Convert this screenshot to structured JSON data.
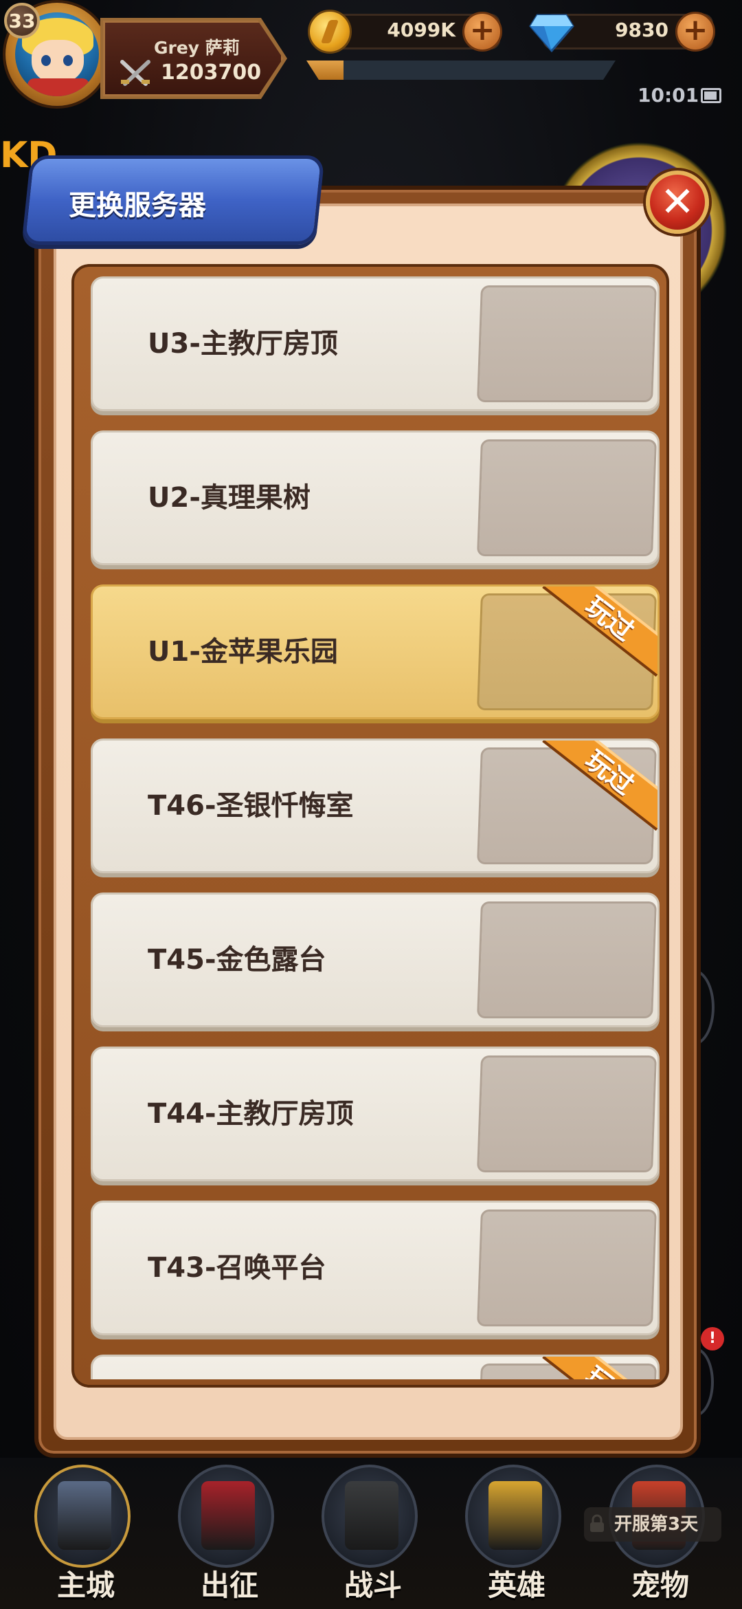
{
  "hud": {
    "level": "33",
    "player_name": "Grey 萨莉",
    "power": "1203700",
    "gold": "4099K",
    "gems": "9830",
    "clock": "10:01",
    "xp_fraction": 0.12,
    "bg_text": "KD"
  },
  "dialog": {
    "title": "更换服务器",
    "close_icon": "close-icon",
    "played_label": "玩过",
    "servers": [
      {
        "name": "U3-主教厅房顶",
        "selected": false,
        "played": false
      },
      {
        "name": "U2-真理果树",
        "selected": false,
        "played": false
      },
      {
        "name": "U1-金苹果乐园",
        "selected": true,
        "played": true
      },
      {
        "name": "T46-圣银忏悔室",
        "selected": false,
        "played": true
      },
      {
        "name": "T45-金色露台",
        "selected": false,
        "played": false
      },
      {
        "name": "T44-主教厅房顶",
        "selected": false,
        "played": false
      },
      {
        "name": "T43-召唤平台",
        "selected": false,
        "played": false
      },
      {
        "name": "",
        "selected": false,
        "played": true
      }
    ]
  },
  "alert_badge": "!",
  "nav": {
    "items": [
      {
        "label": "主城",
        "icon": "castle-icon",
        "active": true
      },
      {
        "label": "出征",
        "icon": "expedition-icon",
        "active": false
      },
      {
        "label": "战斗",
        "icon": "battle-shield-icon",
        "active": false
      },
      {
        "label": "英雄",
        "icon": "hero-crest-icon",
        "active": false
      },
      {
        "label": "宠物",
        "icon": "pet-dragon-icon",
        "active": false
      }
    ],
    "lock_text": "开服第3天"
  },
  "colors": {
    "panel_wood": "#8b4d22",
    "title_blue": "#3f63c6",
    "selected_row": "#e8c06a",
    "ribbon_orange": "#f29a2a"
  }
}
